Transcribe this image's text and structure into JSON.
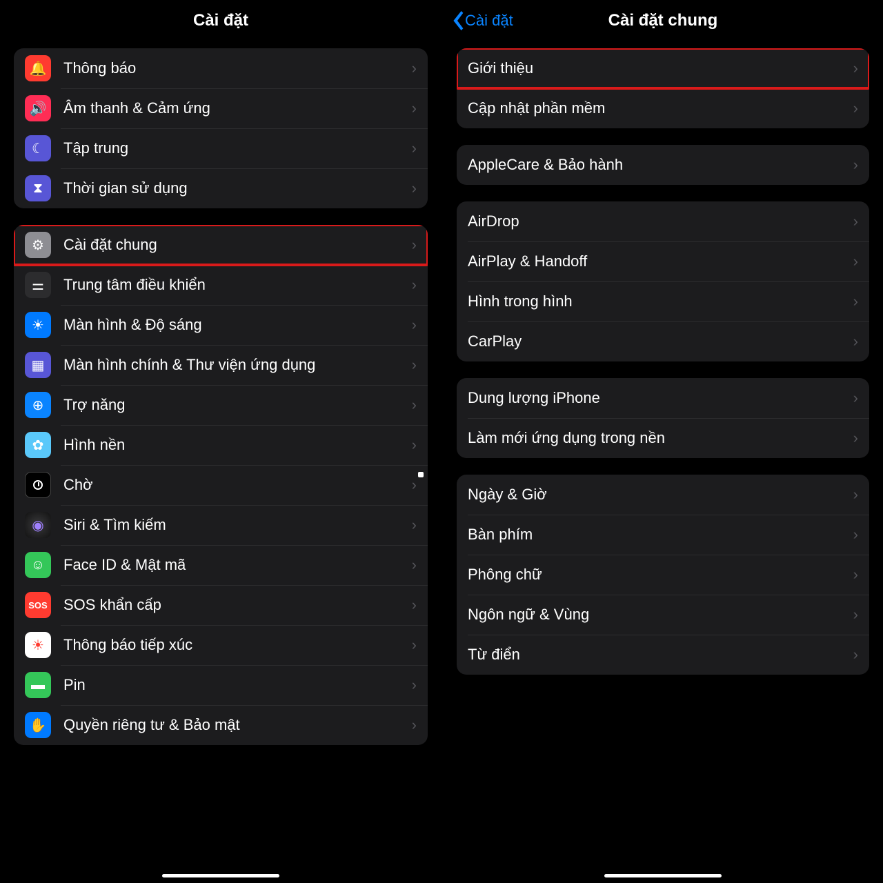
{
  "left": {
    "title": "Cài đặt",
    "groups": [
      {
        "rows": [
          {
            "id": "notifications",
            "label": "Thông báo",
            "icon": "bell-icon",
            "color": "bg-red"
          },
          {
            "id": "sounds",
            "label": "Âm thanh & Cảm ứng",
            "icon": "speaker-icon",
            "color": "bg-pink"
          },
          {
            "id": "focus",
            "label": "Tập trung",
            "icon": "moon-icon",
            "color": "bg-purple"
          },
          {
            "id": "screentime",
            "label": "Thời gian sử dụng",
            "icon": "hourglass-icon",
            "color": "bg-purple"
          }
        ]
      },
      {
        "rows": [
          {
            "id": "general",
            "label": "Cài đặt chung",
            "icon": "gear-icon",
            "color": "bg-gray",
            "highlight": true
          },
          {
            "id": "controlcenter",
            "label": "Trung tâm điều khiển",
            "icon": "toggles-icon",
            "color": "bg-darkgray"
          },
          {
            "id": "display",
            "label": "Màn hình & Độ sáng",
            "icon": "sun-icon",
            "color": "bg-blue"
          },
          {
            "id": "homescreen",
            "label": "Màn hình chính & Thư viện ứng dụng",
            "icon": "grid-icon",
            "color": "bg-purple"
          },
          {
            "id": "accessibility",
            "label": "Trợ năng",
            "icon": "accessibility-icon",
            "color": "bg-blue2"
          },
          {
            "id": "wallpaper",
            "label": "Hình nền",
            "icon": "flower-icon",
            "color": "bg-cyan"
          },
          {
            "id": "standby",
            "label": "Chờ",
            "icon": "clock-icon",
            "color": "bg-black"
          },
          {
            "id": "siri",
            "label": "Siri & Tìm kiếm",
            "icon": "siri-icon",
            "color": "bg-siri"
          },
          {
            "id": "faceid",
            "label": "Face ID & Mật mã",
            "icon": "faceid-icon",
            "color": "bg-green"
          },
          {
            "id": "sos",
            "label": "SOS khẩn cấp",
            "icon": "sos-icon",
            "color": "bg-red"
          },
          {
            "id": "exposure",
            "label": "Thông báo tiếp xúc",
            "icon": "exposure-icon",
            "color": "bg-white"
          },
          {
            "id": "battery",
            "label": "Pin",
            "icon": "battery-icon",
            "color": "bg-green"
          },
          {
            "id": "privacy",
            "label": "Quyền riêng tư & Bảo mật",
            "icon": "hand-icon",
            "color": "bg-blue"
          }
        ]
      }
    ]
  },
  "right": {
    "back": "Cài đặt",
    "title": "Cài đặt chung",
    "groups": [
      {
        "rows": [
          {
            "id": "about",
            "label": "Giới thiệu",
            "highlight": true
          },
          {
            "id": "softwareupdate",
            "label": "Cập nhật phần mềm"
          }
        ]
      },
      {
        "rows": [
          {
            "id": "applecare",
            "label": "AppleCare & Bảo hành"
          }
        ]
      },
      {
        "rows": [
          {
            "id": "airdrop",
            "label": "AirDrop"
          },
          {
            "id": "airplay",
            "label": "AirPlay & Handoff"
          },
          {
            "id": "pip",
            "label": "Hình trong hình"
          },
          {
            "id": "carplay",
            "label": "CarPlay"
          }
        ]
      },
      {
        "rows": [
          {
            "id": "storage",
            "label": "Dung lượng iPhone"
          },
          {
            "id": "backgroundrefresh",
            "label": "Làm mới ứng dụng trong nền"
          }
        ]
      },
      {
        "rows": [
          {
            "id": "datetime",
            "label": "Ngày & Giờ"
          },
          {
            "id": "keyboard",
            "label": "Bàn phím"
          },
          {
            "id": "fonts",
            "label": "Phông chữ"
          },
          {
            "id": "language",
            "label": "Ngôn ngữ & Vùng"
          },
          {
            "id": "dictionary",
            "label": "Từ điển"
          }
        ]
      }
    ]
  },
  "icons": {
    "bell-icon": "🔔",
    "speaker-icon": "🔊",
    "moon-icon": "☾",
    "hourglass-icon": "⧗",
    "gear-icon": "⚙",
    "toggles-icon": "⚌",
    "sun-icon": "☀",
    "grid-icon": "▦",
    "accessibility-icon": "⊕",
    "flower-icon": "✿",
    "clock-icon": "◑",
    "siri-icon": "◉",
    "faceid-icon": "☺",
    "sos-icon": "SOS",
    "exposure-icon": "☀",
    "battery-icon": "▬",
    "hand-icon": "✋"
  }
}
